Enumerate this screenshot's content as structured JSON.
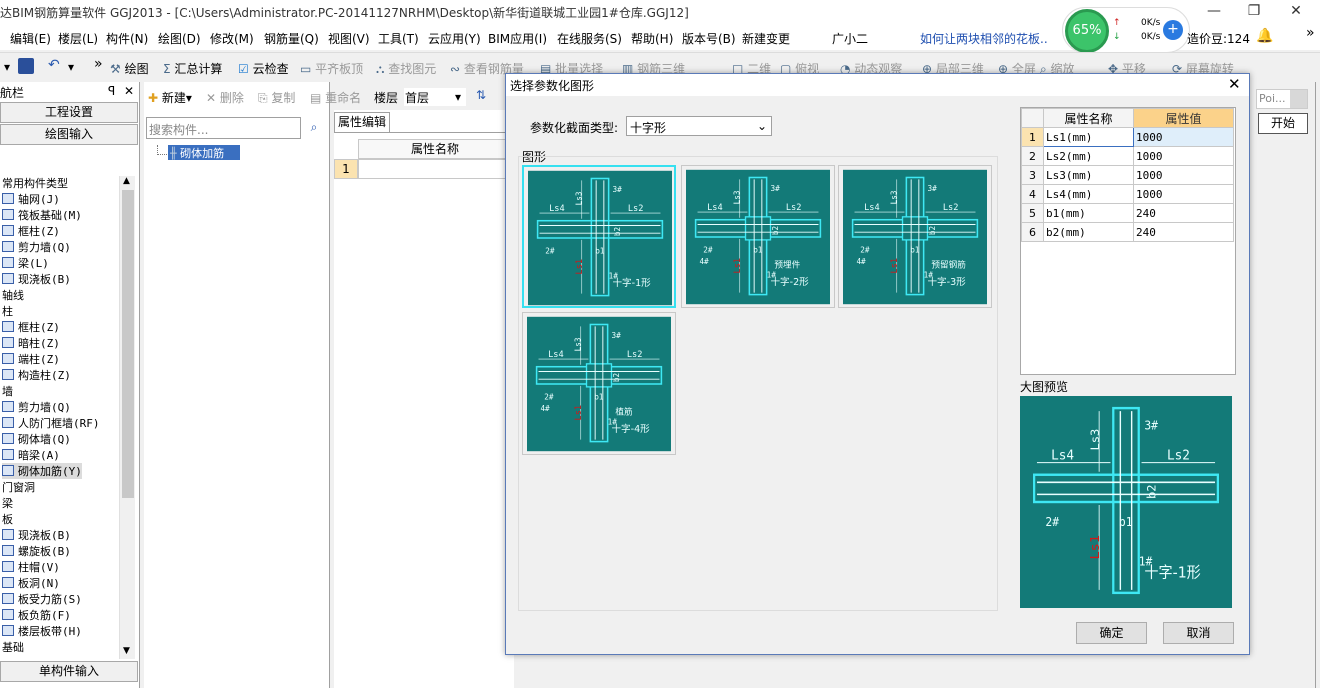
{
  "title": "达BIM钢筋算量软件 GGJ2013 - [C:\\Users\\Administrator.PC-20141127NRHM\\Desktop\\新华街道联城工业园1#仓库.GGJ12]",
  "menu": [
    "编辑(E)",
    "楼层(L)",
    "构件(N)",
    "绘图(D)",
    "修改(M)",
    "钢筋量(Q)",
    "视图(V)",
    "工具(T)",
    "云应用(Y)",
    "BIM应用(I)",
    "在线服务(S)",
    "帮助(H)",
    "版本号(B)",
    "新建变更",
    "广小二"
  ],
  "menu_link": "如何让两块相邻的花板..",
  "net": {
    "percent": "65%",
    "up": "0K/s",
    "down": "0K/s"
  },
  "price": "造价豆:124",
  "toolbar": [
    "绘图",
    "汇总计算",
    "云检查",
    "平齐板顶",
    "查找图元",
    "查看钢筋量",
    "批量选择",
    "钢筋三维",
    "二维",
    "俯视",
    "动态观察",
    "局部三维",
    "全屏",
    "缩放",
    "平移",
    "屏幕旋转"
  ],
  "left": {
    "header": "航栏",
    "btn_project": "工程设置",
    "btn_draw": "绘图输入",
    "btn_single": "单构件输入",
    "items": [
      {
        "t": "常用构件类型",
        "g": true
      },
      {
        "t": "轴网(J)"
      },
      {
        "t": "筏板基础(M)"
      },
      {
        "t": "框柱(Z)"
      },
      {
        "t": "剪力墙(Q)"
      },
      {
        "t": "梁(L)"
      },
      {
        "t": "现浇板(B)"
      },
      {
        "t": "轴线",
        "g": true
      },
      {
        "t": "柱",
        "g": true
      },
      {
        "t": "框柱(Z)"
      },
      {
        "t": "暗柱(Z)"
      },
      {
        "t": "端柱(Z)"
      },
      {
        "t": "构造柱(Z)"
      },
      {
        "t": "墙",
        "g": true
      },
      {
        "t": "剪力墙(Q)"
      },
      {
        "t": "人防门框墙(RF)"
      },
      {
        "t": "砌体墙(Q)"
      },
      {
        "t": "暗梁(A)"
      },
      {
        "t": "砌体加筋(Y)",
        "sel": true
      },
      {
        "t": "门窗洞",
        "g": true
      },
      {
        "t": "梁",
        "g": true
      },
      {
        "t": "板",
        "g": true
      },
      {
        "t": "现浇板(B)"
      },
      {
        "t": "螺旋板(B)"
      },
      {
        "t": "柱帽(V)"
      },
      {
        "t": "板洞(N)"
      },
      {
        "t": "板受力筋(S)"
      },
      {
        "t": "板负筋(F)"
      },
      {
        "t": "楼层板带(H)"
      },
      {
        "t": "基础",
        "g": true
      }
    ]
  },
  "mid": {
    "new": "新建",
    "delete": "删除",
    "copy": "复制",
    "rename": "重命名",
    "floor_label": "楼层",
    "floor": "首层",
    "search_placeholder": "搜索构件...",
    "tree_item": "砌体加筋"
  },
  "props": {
    "tab": "属性编辑",
    "col_name": "属性名称",
    "row1": "1"
  },
  "dialog": {
    "title": "选择参数化图形",
    "type_label": "参数化截面类型:",
    "type_value": "十字形",
    "group_label": "图形",
    "thumbs": [
      {
        "name": "十字-1形",
        "tag": "",
        "bars": [
          "1#",
          "2#",
          "3#"
        ]
      },
      {
        "name": "十字-2形",
        "tag": "预埋件",
        "bars": [
          "1#",
          "2#",
          "3#",
          "4#"
        ]
      },
      {
        "name": "十字-3形",
        "tag": "预留钢筋",
        "bars": [
          "1#",
          "2#",
          "3#",
          "4#"
        ]
      },
      {
        "name": "十字-4形",
        "tag": "植筋",
        "bars": [
          "1#",
          "2#",
          "3#",
          "4#"
        ]
      }
    ],
    "dims": [
      "Ls1",
      "Ls2",
      "Ls3",
      "Ls4",
      "b1",
      "b2"
    ],
    "table_head": [
      "属性名称",
      "属性值"
    ],
    "rows": [
      [
        "1",
        "Ls1(mm)",
        "1000"
      ],
      [
        "2",
        "Ls2(mm)",
        "1000"
      ],
      [
        "3",
        "Ls3(mm)",
        "1000"
      ],
      [
        "4",
        "Ls4(mm)",
        "1000"
      ],
      [
        "5",
        "b1(mm)",
        "240"
      ],
      [
        "6",
        "b2(mm)",
        "240"
      ]
    ],
    "preview_label": "大图预览",
    "ok": "确定",
    "cancel": "取消"
  },
  "right": {
    "poi": "Poi...",
    "start": "开始"
  },
  "colors": {
    "teal": "#137a78",
    "cyan": "#36e0f0",
    "red": "#d01818",
    "accent": "#fbd28a"
  }
}
